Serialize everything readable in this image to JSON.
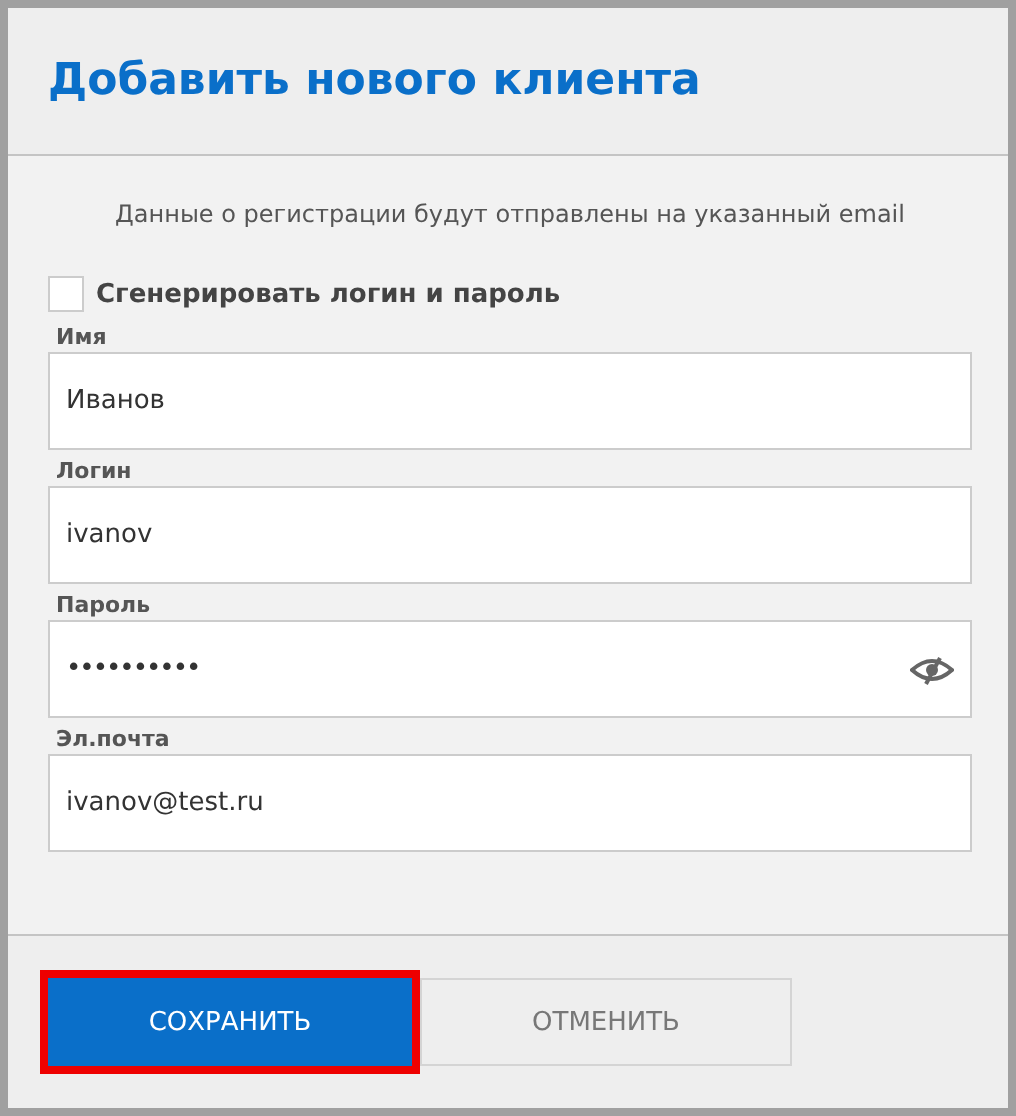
{
  "dialog": {
    "title": "Добавить нового клиента"
  },
  "notice": "Данные о регистрации будут отправлены на указанный email",
  "generate_checkbox": {
    "label": "Сгенерировать логин и пароль",
    "checked": false
  },
  "fields": [
    {
      "label": "Имя",
      "value": "Иванов",
      "kind": "text"
    },
    {
      "label": "Логин",
      "value": "ivanov",
      "kind": "text"
    },
    {
      "label": "Пароль",
      "value": "••••••••••",
      "kind": "password"
    },
    {
      "label": "Эл.почта",
      "value": "ivanov@test.ru",
      "kind": "text"
    }
  ],
  "buttons": [
    {
      "label": "СОХРАНИТЬ",
      "kind": "primary",
      "highlighted": true
    },
    {
      "label": "ОТМЕНИТЬ",
      "kind": "secondary",
      "highlighted": false
    }
  ]
}
